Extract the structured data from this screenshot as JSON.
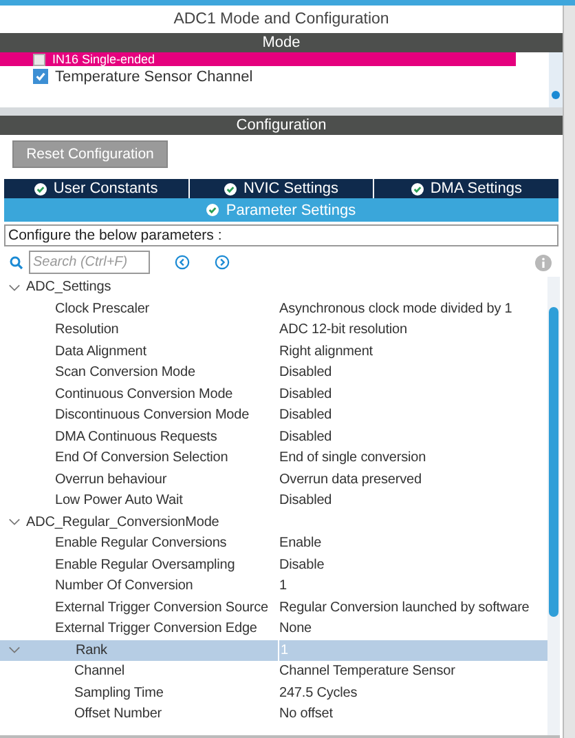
{
  "title": "ADC1 Mode and Configuration",
  "mode": {
    "header": "Mode",
    "channels": [
      {
        "label": "IN16 Single-ended",
        "checked": false,
        "selected": true
      },
      {
        "label": "Temperature Sensor Channel",
        "checked": true,
        "selected": false
      }
    ]
  },
  "configuration": {
    "header": "Configuration",
    "reset_button": "Reset Configuration",
    "tabs": [
      {
        "label": "User Constants",
        "selected": false
      },
      {
        "label": "NVIC Settings",
        "selected": false
      },
      {
        "label": "DMA Settings",
        "selected": false
      },
      {
        "label": "Parameter Settings",
        "selected": true
      }
    ],
    "description": "Configure the below parameters :",
    "search": {
      "placeholder": "Search (Ctrl+F)"
    },
    "tree": [
      {
        "label": "ADC_Settings",
        "expanded": true,
        "selected": false,
        "children": [
          {
            "label": "Clock Prescaler",
            "value": "Asynchronous clock mode divided by 1",
            "selected": false
          },
          {
            "label": "Resolution",
            "value": "ADC 12-bit resolution",
            "selected": false
          },
          {
            "label": "Data Alignment",
            "value": "Right alignment",
            "selected": false
          },
          {
            "label": "Scan Conversion Mode",
            "value": "Disabled",
            "selected": false
          },
          {
            "label": "Continuous Conversion Mode",
            "value": "Disabled",
            "selected": false
          },
          {
            "label": "Discontinuous Conversion Mode",
            "value": "Disabled",
            "selected": false
          },
          {
            "label": "DMA Continuous Requests",
            "value": "Disabled",
            "selected": false
          },
          {
            "label": "End Of Conversion Selection",
            "value": "End of single conversion",
            "selected": false
          },
          {
            "label": "Overrun behaviour",
            "value": "Overrun data preserved",
            "selected": false
          },
          {
            "label": "Low Power Auto Wait",
            "value": "Disabled",
            "selected": false
          }
        ]
      },
      {
        "label": "ADC_Regular_ConversionMode",
        "expanded": true,
        "selected": false,
        "children": [
          {
            "label": "Enable Regular Conversions",
            "value": "Enable",
            "selected": false
          },
          {
            "label": "Enable Regular Oversampling",
            "value": "Disable",
            "selected": false
          },
          {
            "label": "Number Of Conversion",
            "value": "1",
            "selected": false
          },
          {
            "label": "External Trigger Conversion Source",
            "value": "Regular Conversion launched by software",
            "selected": false
          },
          {
            "label": "External Trigger Conversion Edge",
            "value": "None",
            "selected": false
          },
          {
            "label": "Rank",
            "value": "1",
            "expanded": true,
            "selected": true,
            "children": [
              {
                "label": "Channel",
                "value": "Channel Temperature Sensor",
                "selected": false
              },
              {
                "label": "Sampling Time",
                "value": "247.5 Cycles",
                "selected": false
              },
              {
                "label": "Offset Number",
                "value": "No offset",
                "selected": false
              }
            ]
          }
        ]
      }
    ]
  }
}
